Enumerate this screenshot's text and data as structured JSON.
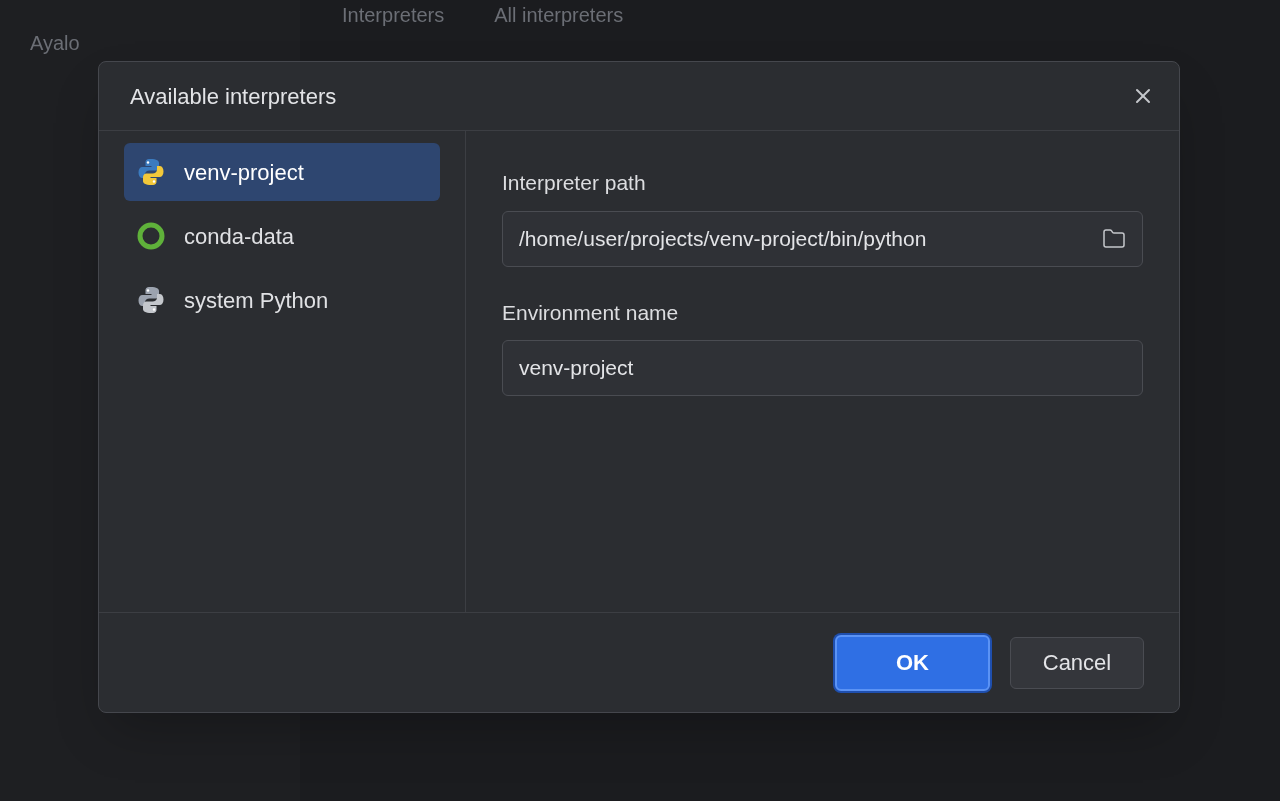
{
  "backdrop": {
    "tabs": [
      {
        "label": "Interpreters"
      },
      {
        "label": "All interpreters"
      }
    ],
    "sidebar_title": "Ayalo"
  },
  "dialog": {
    "title": "Available interpreters",
    "interpreters": [
      {
        "name": "venv-project",
        "kind": "venv",
        "selected": true
      },
      {
        "name": "conda-data",
        "kind": "conda",
        "selected": false
      },
      {
        "name": "system Python",
        "kind": "system",
        "selected": false
      }
    ],
    "fields": [
      {
        "label": "Interpreter path",
        "value": "/home/user/projects/venv-project/bin/python",
        "browse": true
      },
      {
        "label": "Environment name",
        "value": "venv-project",
        "browse": false
      }
    ],
    "buttons": [
      {
        "label": "OK",
        "primary": true
      },
      {
        "label": "Cancel",
        "primary": false
      }
    ]
  }
}
